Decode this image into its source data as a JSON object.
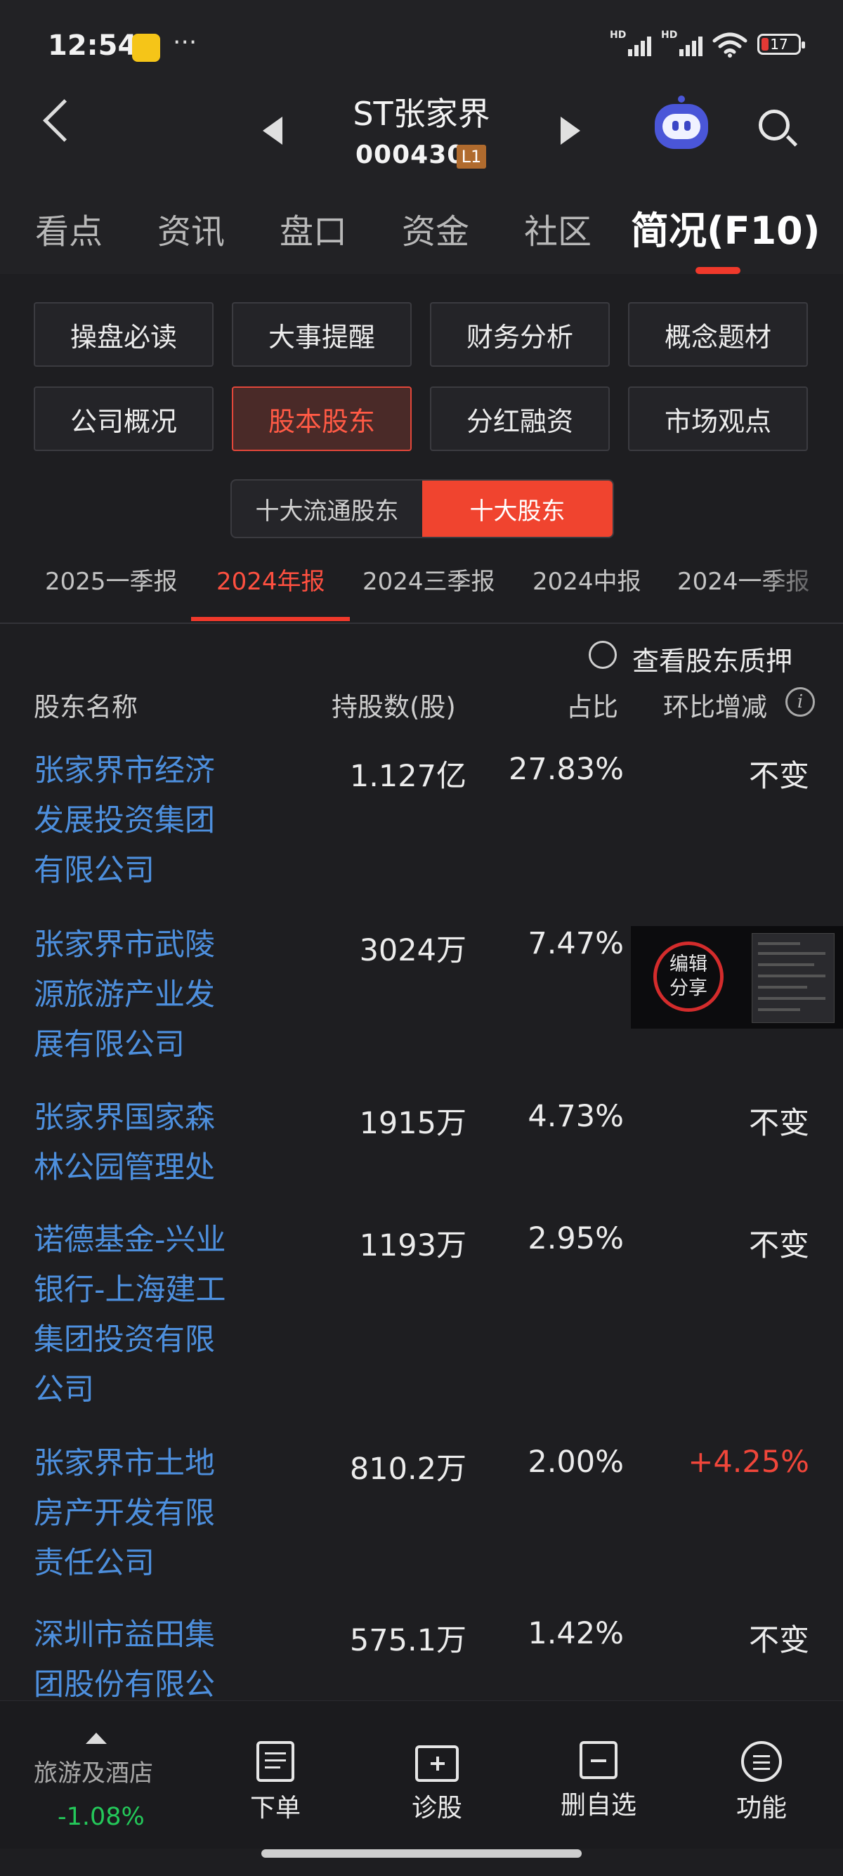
{
  "status_bar": {
    "time": "12:54",
    "dots": "···",
    "signal_label": "HD",
    "battery": "17"
  },
  "header": {
    "stock_name": "ST张家界",
    "stock_code": "000430",
    "level_badge": "L1"
  },
  "main_tabs": [
    {
      "label": "看点"
    },
    {
      "label": "资讯"
    },
    {
      "label": "盘口"
    },
    {
      "label": "资金"
    },
    {
      "label": "社区"
    },
    {
      "label": "简况(F10)"
    }
  ],
  "grid_buttons": [
    {
      "label": "操盘必读"
    },
    {
      "label": "大事提醒"
    },
    {
      "label": "财务分析"
    },
    {
      "label": "概念题材"
    },
    {
      "label": "公司概况"
    },
    {
      "label": "股本股东"
    },
    {
      "label": "分红融资"
    },
    {
      "label": "市场观点"
    }
  ],
  "segment": {
    "left": "十大流通股东",
    "right": "十大股东"
  },
  "period_tabs": [
    {
      "label": "2025一季报"
    },
    {
      "label": "2024年报"
    },
    {
      "label": "2024三季报"
    },
    {
      "label": "2024中报"
    },
    {
      "label": "2024一季报"
    }
  ],
  "pledge_label": "查看股东质押",
  "table": {
    "headers": {
      "name": "股东名称",
      "shares": "持股数(股)",
      "pct": "占比",
      "change": "环比增减"
    },
    "rows": [
      {
        "name_lines": [
          "张家界市经济",
          "发展投资集团",
          "有限公司"
        ],
        "shares": "1.127亿",
        "pct": "27.83%",
        "change": "不变"
      },
      {
        "name_lines": [
          "张家界市武陵",
          "源旅游产业发",
          "展有限公司"
        ],
        "shares": "3024万",
        "pct": "7.47%",
        "change": ""
      },
      {
        "name_lines": [
          "张家界国家森",
          "林公园管理处"
        ],
        "shares": "1915万",
        "pct": "4.73%",
        "change": "不变"
      },
      {
        "name_lines": [
          "诺德基金-兴业",
          "银行-上海建工",
          "集团投资有限",
          "公司"
        ],
        "shares": "1193万",
        "pct": "2.95%",
        "change": "不变"
      },
      {
        "name_lines": [
          "张家界市土地",
          "房产开发有限",
          "责任公司"
        ],
        "shares": "810.2万",
        "pct": "2.00%",
        "change": "+4.25%"
      },
      {
        "name_lines": [
          "深圳市益田集",
          "团股份有限公"
        ],
        "shares": "575.1万",
        "pct": "1.42%",
        "change": "不变"
      }
    ]
  },
  "share_popup": {
    "line1": "编辑",
    "line2": "分享"
  },
  "bottom_bar": {
    "industry": "旅游及酒店",
    "industry_change": "-1.08%",
    "items": [
      {
        "label": "下单"
      },
      {
        "label": "诊股"
      },
      {
        "label": "删自选"
      },
      {
        "label": "功能"
      }
    ]
  },
  "colors": {
    "accent": "#f0392b",
    "link": "#4d8fdd",
    "up": "#f0463a",
    "down": "#24c85a"
  }
}
